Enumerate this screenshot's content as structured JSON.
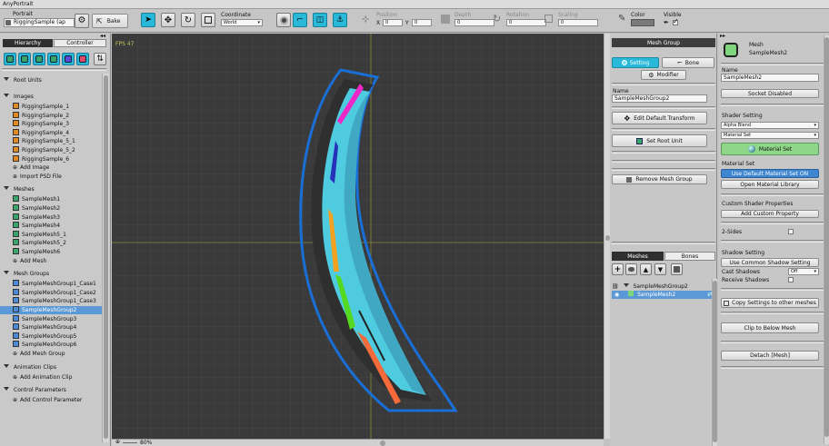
{
  "window": {
    "title": "AnyPortrait"
  },
  "toolbar": {
    "portrait_label": "Portrait",
    "portrait_value": "RiggingSample (ap",
    "bake_label": "Bake",
    "coordinate_label": "Coordinate",
    "coordinate_value": "World",
    "position_label": "Position",
    "x_label": "X",
    "x_value": "0",
    "y_label": "Y",
    "y_value": "0",
    "depth_label": "Depth",
    "depth_value": "0",
    "rotation_label": "Rotation",
    "rotation_value": "0",
    "scaling_label": "Scaling",
    "scaling_value": "0",
    "color_label": "Color",
    "visible_label": "Visible"
  },
  "left_panel": {
    "tab_hierarchy": "Hierarchy",
    "tab_controller": "Controller",
    "sections": [
      {
        "title": "Root Units",
        "items": []
      },
      {
        "title": "Images",
        "items": [
          "RiggingSample_1",
          "RiggingSample_2",
          "RiggingSample_3",
          "RiggingSample_4",
          "RiggingSample_5_1",
          "RiggingSample_5_2",
          "RiggingSample_6"
        ],
        "add": [
          "Add Image",
          "Import PSD File"
        ]
      },
      {
        "title": "Meshes",
        "items": [
          "SampleMesh1",
          "SampleMesh2",
          "SampleMesh3",
          "SampleMesh4",
          "SampleMesh5_1",
          "SampleMesh5_2",
          "SampleMesh6"
        ],
        "add": [
          "Add Mesh"
        ]
      },
      {
        "title": "Mesh Groups",
        "items": [
          "SampleMeshGroup1_Case1",
          "SampleMeshGroup1_Case2",
          "SampleMeshGroup1_Case3",
          "SampleMeshGroup2",
          "SampleMeshGroup3",
          "SampleMeshGroup4",
          "SampleMeshGroup5",
          "SampleMeshGroup6"
        ],
        "add": [
          "Add Mesh Group"
        ]
      },
      {
        "title": "Animation Clips",
        "items": [],
        "add": [
          "Add Animation Clip"
        ]
      },
      {
        "title": "Control Parameters",
        "items": [],
        "add": [
          "Add Control Parameter"
        ]
      }
    ],
    "selected_item": "SampleMeshGroup2"
  },
  "viewport": {
    "fps": "FPS 47",
    "zoom": "80%"
  },
  "mesh_group_panel": {
    "header": "Mesh Group",
    "tab_setting": "Setting",
    "tab_bone": "Bone",
    "modifier_button": "Modifier",
    "name_label": "Name",
    "name_value": "SampleMeshGroup2",
    "edit_default_transform": "Edit Default Transform",
    "set_root_unit": "Set Root Unit",
    "remove_mesh_group": "Remove Mesh Group",
    "tab_meshes": "Meshes",
    "tab_bones": "Bones",
    "tree_group": "SampleMeshGroup2",
    "tree_mesh": "SampleMesh2"
  },
  "inspector": {
    "type_label": "Mesh",
    "mesh_name": "SampleMesh2",
    "name_label": "Name",
    "name_value": "SampleMesh2",
    "socket_button": "Socket Disabled",
    "shader_setting_label": "Shader Setting",
    "blend_value": "Alpha Blend",
    "material_set_value": "Material Set",
    "material_set_button": "Material Set",
    "material_set_label": "Material Set",
    "use_default_material": "Use Default Material Set ON",
    "open_material_library": "Open Material Library",
    "custom_shader_label": "Custom Shader Properties",
    "add_custom_property": "Add Custom Property",
    "two_sides_label": "2-Sides",
    "shadow_setting_label": "Shadow Setting",
    "common_shadow_button": "Use Common Shadow Setting",
    "cast_shadows_label": "Cast Shadows",
    "cast_shadows_value": "Off",
    "receive_shadows_label": "Receive Shadows",
    "copy_settings_button": "Copy Settings to other meshes",
    "clip_below_button": "Clip to Below Mesh",
    "detach_button": "Detach [Mesh]"
  },
  "colors": {
    "accent": "#29b8d8",
    "selection": "#5b99d6",
    "viewport_bg": "#3a3a3a",
    "active_blue": "#3e86cf",
    "green_button": "#8fd68a"
  }
}
